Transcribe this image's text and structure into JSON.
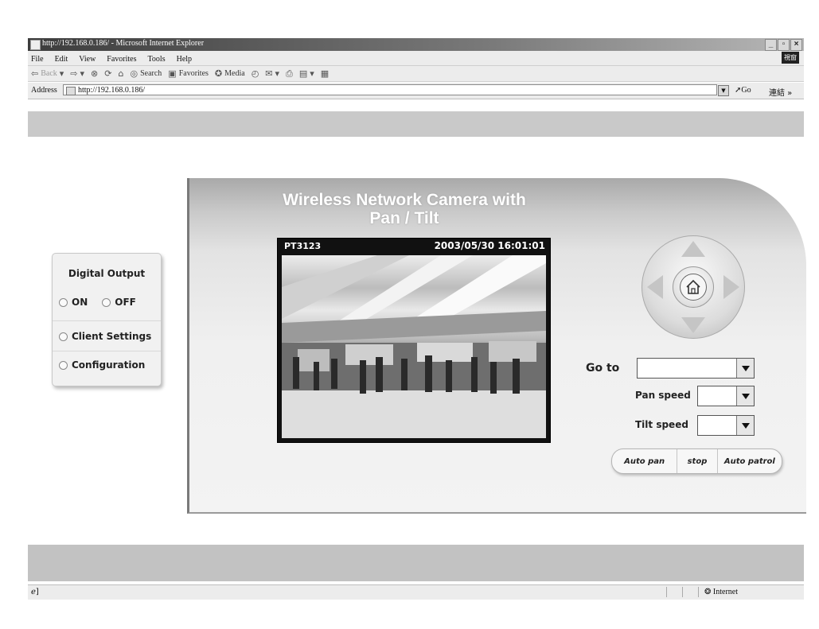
{
  "window": {
    "title": "http://192.168.0.186/ - Microsoft Internet Explorer",
    "buttons": [
      "_",
      "▫",
      "×"
    ]
  },
  "menu": {
    "items": [
      "File",
      "Edit",
      "View",
      "Favorites",
      "Tools",
      "Help"
    ],
    "logo": "視窗"
  },
  "toolbar": {
    "back": "Back",
    "search": "Search",
    "favorites": "Favorites",
    "media": "Media"
  },
  "address": {
    "label": "Address",
    "url": "http://192.168.0.186/",
    "go": "Go",
    "links": "連結"
  },
  "page": {
    "title_line1": "Wireless Network Camera with",
    "title_line2": "Pan / Tilt"
  },
  "left_panel": {
    "digital_output": "Digital Output",
    "on": "ON",
    "off": "OFF",
    "client_settings": "Client Settings",
    "configuration": "Configuration"
  },
  "video": {
    "camera_name": "PT3123",
    "timestamp": "2003/05/30  16:01:01"
  },
  "controls": {
    "goto_label": "Go to",
    "goto_value": "",
    "pan_speed_label": "Pan speed",
    "pan_speed_value": "",
    "tilt_speed_label": "Tilt speed",
    "tilt_speed_value": "",
    "auto_pan": "Auto pan",
    "stop": "stop",
    "auto_patrol": "Auto patrol"
  },
  "status": {
    "zone": "Internet"
  },
  "colors": {
    "title_bar_dark": "#3c3c3c",
    "panel_border": "#7a7a7a"
  }
}
